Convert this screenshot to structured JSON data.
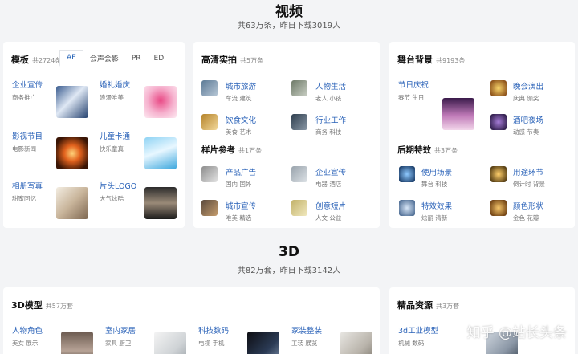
{
  "video": {
    "title": "视频",
    "subtitle": "共63万条，昨日下载3019人",
    "template": {
      "title": "模板",
      "count": "共2724条",
      "tabs": [
        "AE",
        "会声会影",
        "PR",
        "ED"
      ],
      "items": [
        {
          "title": "企业宣传",
          "tags": "商务推广"
        },
        {
          "title": "婚礼婚庆",
          "tags": "浪漫唯美"
        },
        {
          "title": "影视节目",
          "tags": "电影新闻"
        },
        {
          "title": "儿童卡通",
          "tags": "快乐童真"
        },
        {
          "title": "相册写真",
          "tags": "甜蜜回忆"
        },
        {
          "title": "片头LOGO",
          "tags": "大气炫酷"
        }
      ]
    },
    "hd": {
      "title": "高清实拍",
      "count": "共5万条",
      "items": [
        {
          "title": "城市旅游",
          "tags": "车流 建筑"
        },
        {
          "title": "人物生活",
          "tags": "老人 小孩"
        },
        {
          "title": "饮食文化",
          "tags": "美食 艺术"
        },
        {
          "title": "行业工作",
          "tags": "商务 科技"
        }
      ],
      "sample": {
        "title": "样片参考",
        "count": "共1万条",
        "items": [
          {
            "title": "产品广告",
            "tags": "国内 国外"
          },
          {
            "title": "企业宣传",
            "tags": "电器 酒店"
          },
          {
            "title": "城市宣传",
            "tags": "唯美 精选"
          },
          {
            "title": "创意短片",
            "tags": "人文 公益"
          }
        ]
      }
    },
    "stage": {
      "title": "舞台背景",
      "count": "共9193条",
      "items": [
        {
          "title": "节日庆祝",
          "tags": "春节 生日"
        },
        {
          "title": "晚会演出",
          "tags": "庆典 颁奖"
        },
        {
          "title": "酒吧夜场",
          "tags": "动感 节奏"
        }
      ],
      "post": {
        "title": "后期特效",
        "count": "共3万条",
        "items": [
          {
            "title": "使用场景",
            "tags": "舞台 科技"
          },
          {
            "title": "用途环节",
            "tags": "倒计时 背景"
          },
          {
            "title": "特效效果",
            "tags": "炫丽 清新"
          },
          {
            "title": "颜色形状",
            "tags": "金色 花瓣"
          }
        ]
      }
    }
  },
  "threed": {
    "title": "3D",
    "subtitle": "共82万套，昨日下载3142人",
    "model": {
      "title": "3D模型",
      "count": "共57万套",
      "items": [
        {
          "title": "人物角色",
          "tags": "美女 展示"
        },
        {
          "title": "室内家居",
          "tags": "家具 厨卫"
        },
        {
          "title": "科技数码",
          "tags": "电视 手机"
        },
        {
          "title": "家装整装",
          "tags": "工装 展览"
        }
      ]
    },
    "premium": {
      "title": "精品资源",
      "count": "共3万套",
      "items": [
        {
          "title": "3d工业模型",
          "tags": "机械 数码"
        }
      ]
    }
  },
  "watermark": "知乎 @站长头条"
}
